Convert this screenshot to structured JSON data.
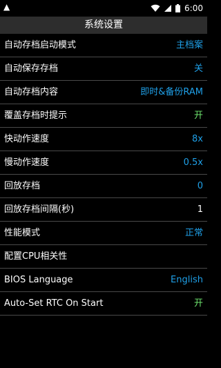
{
  "status_bar": {
    "time": "6:00",
    "icons": [
      "app-notification-icon",
      "wifi-icon",
      "signal-icon",
      "battery-icon"
    ]
  },
  "header": {
    "title": "系统设置"
  },
  "colors": {
    "blue_value": "#1fa0e8",
    "green_value": "#6ee36e",
    "title_bar": "#2d2d2d",
    "divider": "#4a4a4a"
  },
  "settings": [
    {
      "label": "自动存档启动模式",
      "value": "主档案"
    },
    {
      "label": "自动保存存档",
      "value": "关"
    },
    {
      "label": "自动存档内容",
      "value": "即时&备份RAM"
    },
    {
      "label": "覆盖存档时提示",
      "value": "开"
    },
    {
      "label": "快动作速度",
      "value": "8x"
    },
    {
      "label": "慢动作速度",
      "value": "0.5x"
    },
    {
      "label": "回放存档",
      "value": "0"
    },
    {
      "label": "回放存档间隔(秒)",
      "value": "1"
    },
    {
      "label": "性能模式",
      "value": "正常"
    },
    {
      "label": "配置CPU相关性",
      "value": ""
    },
    {
      "label": "BIOS Language",
      "value": "English"
    },
    {
      "label": "Auto-Set RTC On Start",
      "value": "开"
    }
  ]
}
